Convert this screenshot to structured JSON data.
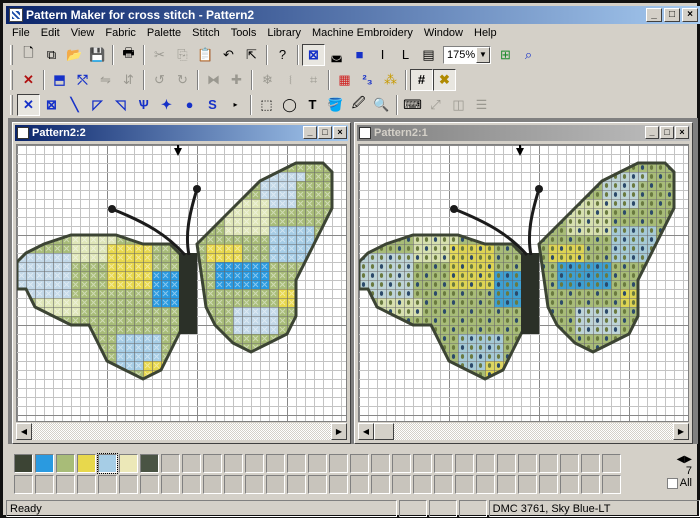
{
  "app": {
    "title": "Pattern Maker for cross stitch - Pattern2"
  },
  "menu": [
    "File",
    "Edit",
    "View",
    "Fabric",
    "Palette",
    "Stitch",
    "Tools",
    "Library",
    "Machine Embroidery",
    "Window",
    "Help"
  ],
  "toolbar": {
    "zoom_value": "175%"
  },
  "windows": [
    {
      "title": "Pattern2:2",
      "state": "active"
    },
    {
      "title": "Pattern2:1",
      "state": "inactive"
    }
  ],
  "palette": {
    "colors": [
      "#3c4434",
      "#2a9ae0",
      "#a8bc78",
      "#e8d84c",
      "#a6cde6",
      "#ece8b8",
      "#4a5444"
    ],
    "selected_index": 4,
    "side_number": "7",
    "all_label": "All"
  },
  "status": {
    "text": "Ready",
    "color_info": "DMC  3761, Sky Blue-LT"
  }
}
